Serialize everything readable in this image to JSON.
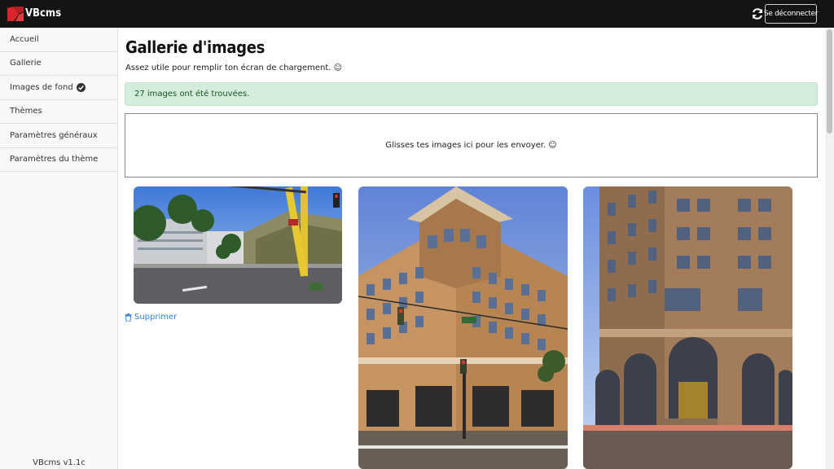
{
  "app": {
    "name": "VBcms",
    "version_label": "VBcms v1.1c"
  },
  "topbar": {
    "logout_label": "Se déconnecter"
  },
  "sidebar": {
    "items": [
      {
        "label": "Accueil"
      },
      {
        "label": "Gallerie"
      },
      {
        "label": "Images de fond",
        "icon": "check-circle-icon"
      },
      {
        "label": "Thèmes"
      },
      {
        "label": "Paramètres généraux"
      },
      {
        "label": "Paramètres du thème"
      }
    ]
  },
  "main": {
    "title": "Gallerie d'images",
    "subtitle": "Assez utile pour remplir ton écran de chargement. ☺",
    "alert": "27 images ont été trouvées.",
    "dropzone": "Glisses tes images ici pour les envoyer. ☺",
    "delete_label": "Supprimer"
  },
  "colors": {
    "topbar": "#141414",
    "accent": "#2f7fd1",
    "alert_bg": "#d4edda",
    "alert_text": "#155724",
    "logo_red": "#d9262c"
  }
}
